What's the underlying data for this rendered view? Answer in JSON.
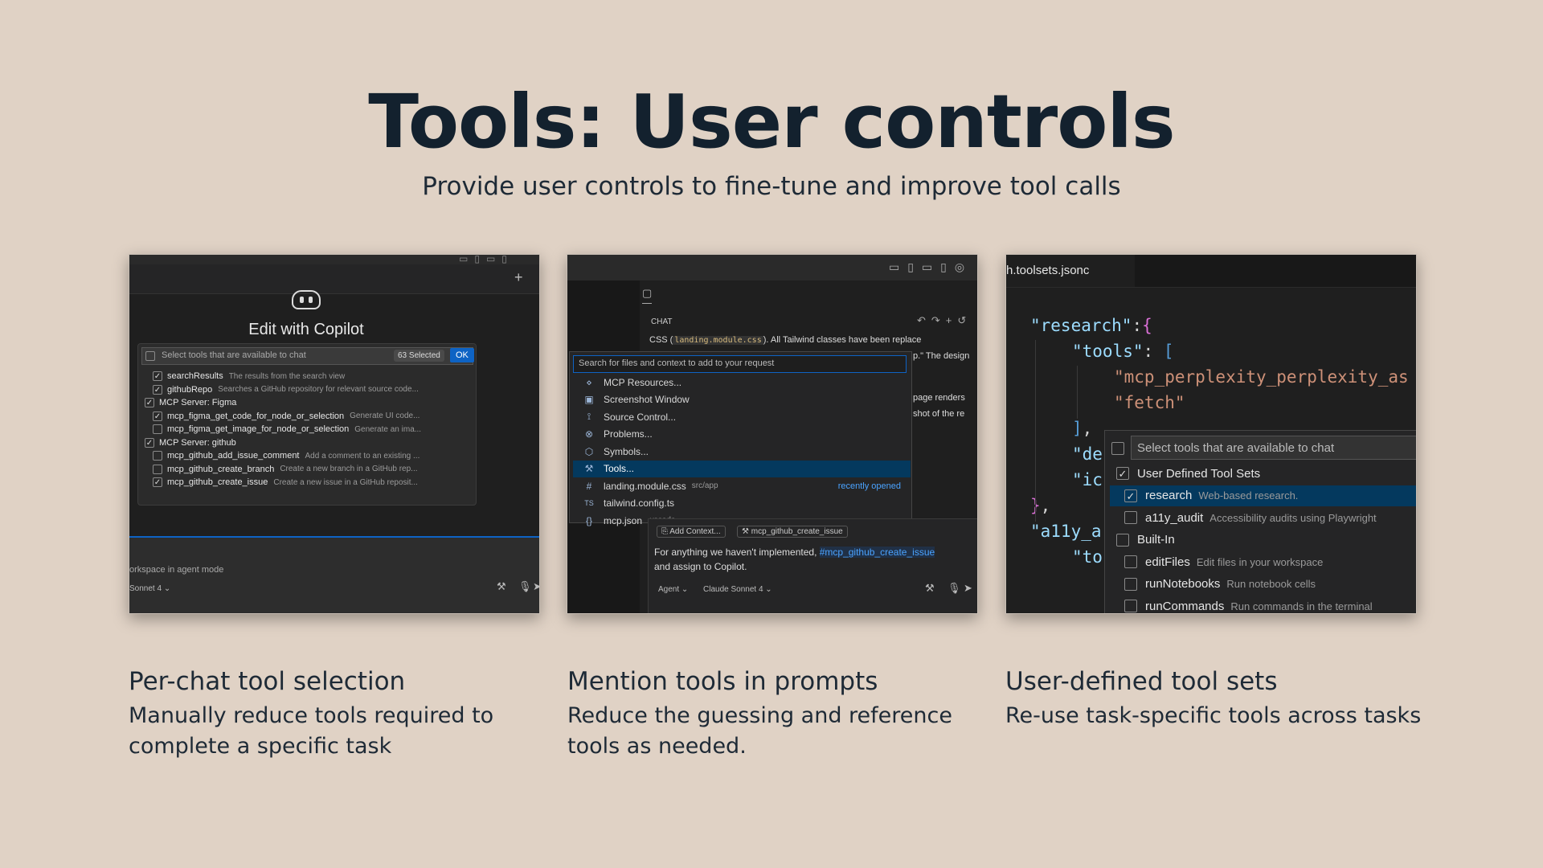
{
  "slide": {
    "title": "Tools: User controls",
    "subtitle": "Provide user controls to fine-tune and improve tool calls"
  },
  "panels": [
    {
      "heading": "Per-chat tool selection",
      "text": "Manually reduce tools required to complete a specific task",
      "screenshot": {
        "dialog_title": "Edit with Copilot",
        "picker_placeholder": "Select tools that are available to chat",
        "selected_badge": "63 Selected",
        "ok_label": "OK",
        "items": [
          {
            "label": "searchResults",
            "desc": "The results from the search view",
            "checked": true,
            "indent": 1
          },
          {
            "label": "githubRepo",
            "desc": "Searches a GitHub repository for relevant source code...",
            "checked": true,
            "indent": 1
          },
          {
            "label": "MCP Server: Figma",
            "desc": "",
            "checked": true,
            "indent": 0
          },
          {
            "label": "mcp_figma_get_code_for_node_or_selection",
            "desc": "Generate UI code...",
            "checked": true,
            "indent": 1
          },
          {
            "label": "mcp_figma_get_image_for_node_or_selection",
            "desc": "Generate an ima...",
            "checked": false,
            "indent": 1
          },
          {
            "label": "MCP Server: github",
            "desc": "",
            "checked": true,
            "indent": 0
          },
          {
            "label": "mcp_github_add_issue_comment",
            "desc": "Add a comment to an existing ...",
            "checked": false,
            "indent": 1
          },
          {
            "label": "mcp_github_create_branch",
            "desc": "Create a new branch in a GitHub rep...",
            "checked": false,
            "indent": 1
          },
          {
            "label": "mcp_github_create_issue",
            "desc": "Create a new issue in a GitHub reposit...",
            "checked": true,
            "indent": 1
          }
        ],
        "input_hint": "orkspace in agent mode",
        "model_label": "Sonnet 4 ⌄"
      }
    },
    {
      "heading": "Mention tools in prompts",
      "text": "Reduce the guessing and reference tools as needed.",
      "screenshot": {
        "chat_label": "CHAT",
        "chat_line1_prefix": "CSS (",
        "chat_line1_code": "landing.module.css",
        "chat_line1_suffix": "). All Tailwind classes have been replace",
        "chat_line2": "p.\" The design",
        "chat_line3": "page renders",
        "chat_line4": "shot of the re",
        "search_placeholder": "Search for files and context to add to your request",
        "menu_items": [
          {
            "icon": "⋄",
            "label": "MCP Resources...",
            "note": ""
          },
          {
            "icon": "▣",
            "label": "Screenshot Window",
            "note": ""
          },
          {
            "icon": "⟟",
            "label": "Source Control...",
            "note": ""
          },
          {
            "icon": "⊗",
            "label": "Problems...",
            "note": ""
          },
          {
            "icon": "⬡",
            "label": "Symbols...",
            "note": ""
          },
          {
            "icon": "⚒",
            "label": "Tools...",
            "note": ""
          },
          {
            "icon": "#",
            "label": "landing.module.css",
            "note": "src/app"
          },
          {
            "icon": "TS",
            "label": "tailwind.config.ts",
            "note": ""
          },
          {
            "icon": "{}",
            "label": "mcp.json",
            "note": ".vscode"
          }
        ],
        "recently_opened": "recently opened",
        "add_context": "Add Context...",
        "tool_chip": "mcp_github_create_issue",
        "prompt_prefix": "For anything we haven't implemented, ",
        "prompt_mention": "#mcp_github_create_issue",
        "prompt_line2": "and assign to Copilot.",
        "agent_label": "Agent ⌄",
        "model_label": "Claude Sonnet 4 ⌄"
      }
    },
    {
      "heading": "User-defined tool sets",
      "text": "Re-use task-specific tools across tasks",
      "screenshot": {
        "tab_title": "h.toolsets.jsonc",
        "code_research": "\"research\"",
        "code_tools": "\"tools\"",
        "code_perplexity": "\"mcp_perplexity_perplexity_as",
        "code_fetch": "\"fetch\"",
        "code_de": "\"de",
        "code_ic": "\"ic",
        "code_a11y": "\"a11y_a",
        "code_to": "\"to",
        "picker_placeholder": "Select tools that are available to chat",
        "items": [
          {
            "label": "User Defined Tool Sets",
            "desc": "",
            "checked": true,
            "indent": 0,
            "selected": false
          },
          {
            "label": "research",
            "desc": "Web-based research.",
            "checked": true,
            "indent": 1,
            "selected": true
          },
          {
            "label": "a11y_audit",
            "desc": "Accessibility audits using Playwright",
            "checked": false,
            "indent": 1,
            "selected": false
          },
          {
            "label": "Built-In",
            "desc": "",
            "checked": false,
            "indent": 0,
            "selected": false
          },
          {
            "label": "editFiles",
            "desc": "Edit files in your workspace",
            "checked": false,
            "indent": 1,
            "selected": false
          },
          {
            "label": "runNotebooks",
            "desc": "Run notebook cells",
            "checked": false,
            "indent": 1,
            "selected": false
          },
          {
            "label": "runCommands",
            "desc": "Run commands in the terminal",
            "checked": false,
            "indent": 1,
            "selected": false
          }
        ]
      }
    }
  ]
}
